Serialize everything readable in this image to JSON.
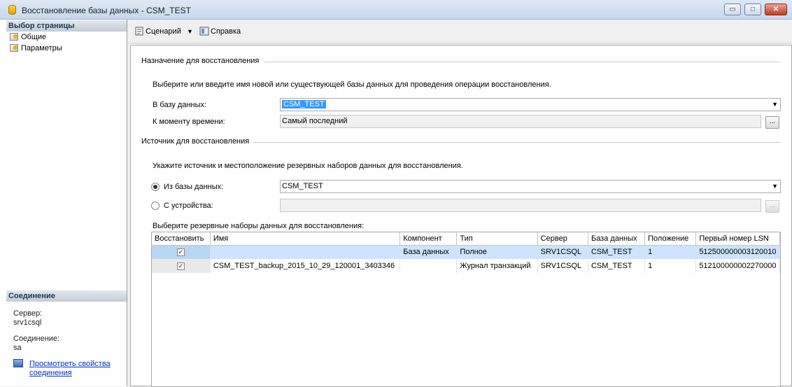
{
  "window": {
    "title": "Восстановление базы данных - CSM_TEST",
    "minimize": "▭",
    "maximize": "□",
    "close": "✕"
  },
  "left_pane": {
    "header": "Выбор страницы",
    "pages": [
      {
        "label": "Общие"
      },
      {
        "label": "Параметры"
      }
    ],
    "connection": {
      "header": "Соединение",
      "server_label": "Сервер:",
      "server_value": "srv1csql",
      "connection_label": "Соединение:",
      "connection_value": "sa",
      "view_link_line1": "Просмотреть свойства",
      "view_link_line2": "соединения"
    }
  },
  "toolbar": {
    "script_label": "Сценарий",
    "help_label": "Справка"
  },
  "destination": {
    "group_title": "Назначение для восстановления",
    "description": "Выберите или введите имя новой или существующей базы данных для проведения операции восстановления.",
    "to_database_label": "В базу данных:",
    "to_database_value": "CSM_TEST",
    "point_in_time_label": "К моменту времени:",
    "point_in_time_value": "Самый последний",
    "browse_label": "..."
  },
  "source": {
    "group_title": "Источник для восстановления",
    "description": "Укажите источник и местоположение резервных наборов данных для восстановления.",
    "from_database_label": "Из базы данных:",
    "from_database_value": "CSM_TEST",
    "from_device_label": "С устройства:",
    "from_device_value": "",
    "browse_label": "...",
    "selected_option": "from_database"
  },
  "backup_sets": {
    "label": "Выберите резервные наборы данных для восстановления:",
    "columns": [
      "Восстановить",
      "Имя",
      "Компонент",
      "Тип",
      "Сервер",
      "База данных",
      "Положение",
      "Первый номер LSN"
    ],
    "rows": [
      {
        "restore": "✓",
        "name": "",
        "component": "База данных",
        "type": "Полное",
        "server": "SRV1CSQL",
        "database": "CSM_TEST",
        "position": "1",
        "first_lsn": "512500000003120010"
      },
      {
        "restore": "✓",
        "name": "CSM_TEST_backup_2015_10_29_120001_3403346",
        "component": "",
        "type": "Журнал транзакций",
        "server": "SRV1CSQL",
        "database": "CSM_TEST",
        "position": "1",
        "first_lsn": "512100000002270000"
      }
    ]
  }
}
